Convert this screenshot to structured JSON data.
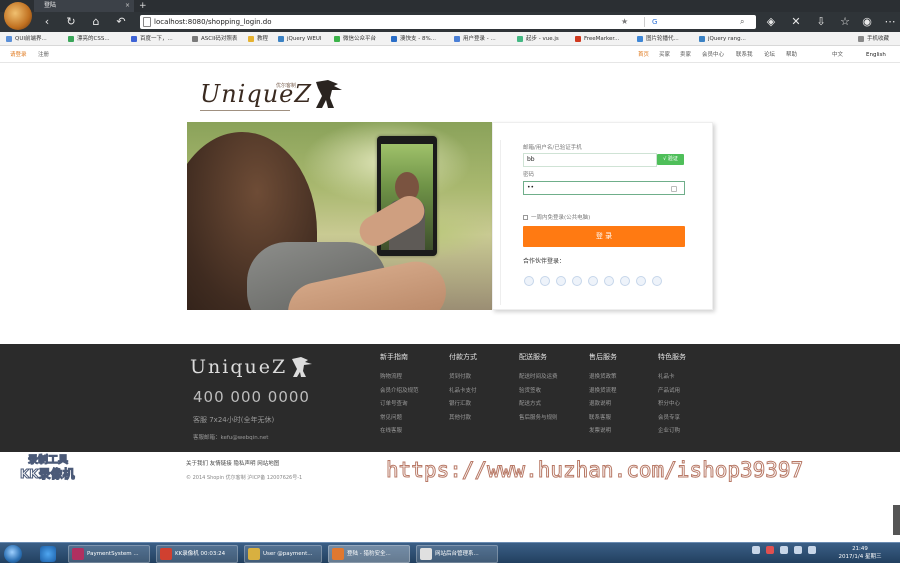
{
  "browser": {
    "tab_title": "登陆",
    "tab_close": "×",
    "new_tab": "+",
    "url": "localhost:8080/shopping_login.do",
    "search_engine_label": "G",
    "bookmarks": [
      {
        "label": "QUI前端界...",
        "color": "#5a8fd8"
      },
      {
        "label": "漂亮的CSS...",
        "color": "#3aa659"
      },
      {
        "label": "百度一下，...",
        "color": "#3e63d6"
      },
      {
        "label": "ASCII码对照表",
        "color": "#7a7a7a"
      },
      {
        "label": "教程",
        "color": "#e6b230"
      },
      {
        "label": "jQuery WEUI",
        "color": "#3b82c4"
      },
      {
        "label": "微信公众平台",
        "color": "#3bb34a"
      },
      {
        "label": "澳快支 - 8%...",
        "color": "#2a6ec8"
      },
      {
        "label": "用户登录 - ...",
        "color": "#4a7fd6"
      },
      {
        "label": "起步 - vue.js",
        "color": "#43b883"
      },
      {
        "label": "FreeMarker...",
        "color": "#d0391f"
      },
      {
        "label": "图片轮播代...",
        "color": "#3d86d6"
      },
      {
        "label": "jQuery rang...",
        "color": "#3b82c4"
      },
      {
        "label": "手机收藏",
        "color": "#888888"
      }
    ]
  },
  "site_top": {
    "left": [
      "请登录",
      "注册"
    ],
    "right": [
      "首页",
      "买家",
      "卖家",
      "会员中心",
      "联系我",
      "论坛",
      "帮助",
      "中文",
      "English"
    ]
  },
  "logo": {
    "text": "UniqueZ",
    "tagline": "优尔客制"
  },
  "login": {
    "username_label": "邮箱/用户名/已验证手机",
    "username_value": "bb",
    "verify_label": "√ 验证",
    "password_label": "密码",
    "password_value": "••",
    "remember_label": "一周内免登录(公共电脑)",
    "submit_label": "登 录",
    "partner_title": "合作伙伴登录："
  },
  "footer": {
    "logo": "UniqueZ",
    "phone": "400 000 0000",
    "service_hours": "客服 7x24小时(全年无休)",
    "email": "客服邮箱：kefu@webqin.net",
    "columns": [
      {
        "title": "新手指南",
        "items": [
          "购物流程",
          "会员介绍及规范",
          "订单号查询",
          "常见问题",
          "在线客服"
        ]
      },
      {
        "title": "付款方式",
        "items": [
          "货到付款",
          "礼品卡支付",
          "银行汇款",
          "其他付款"
        ]
      },
      {
        "title": "配送服务",
        "items": [
          "配送时间及运费",
          "验货签收",
          "配送方式",
          "售后服务与规则"
        ]
      },
      {
        "title": "售后服务",
        "items": [
          "退换货政策",
          "退换货流程",
          "退款说明",
          "联系客服",
          "发票说明"
        ]
      },
      {
        "title": "特色服务",
        "items": [
          "礼品卡",
          "产品试用",
          "积分中心",
          "会员专享",
          "企业订购"
        ]
      }
    ],
    "bottom_links": "关于我们  友情链接  隐私声明  网站地图",
    "copyright": "© 2014  Shopin  优尔客制  沪ICP备 12007626号-1"
  },
  "overlay": {
    "watermark": "https://www.huzhan.com/ishop39397",
    "kk_line1": "录制工具",
    "kk_line2": "KK录像机"
  },
  "taskbar": {
    "tasks": [
      {
        "label": "PaymentSystem ...",
        "color": "#b03060"
      },
      {
        "label": "KK录像机  00:03:24",
        "color": "#d04030"
      },
      {
        "label": "User @payment...",
        "color": "#d8b040"
      },
      {
        "label": "登陆 - 猎豹安全...",
        "color": "#e07830"
      },
      {
        "label": "网站后台管理系...",
        "color": "#e0e0e0"
      }
    ],
    "time": "21:49",
    "date": "2017/1/4 星期三"
  }
}
